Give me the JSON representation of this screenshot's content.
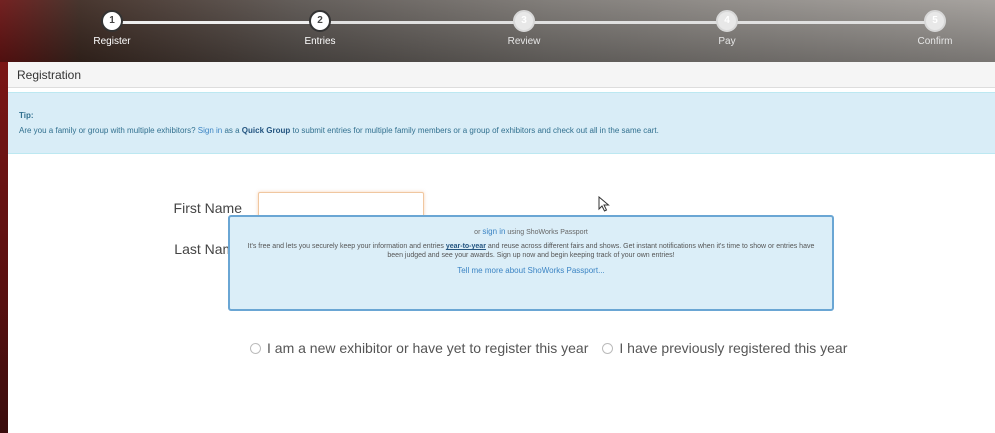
{
  "wizard": {
    "steps": [
      {
        "number": "1",
        "label": "Register",
        "state": "done"
      },
      {
        "number": "2",
        "label": "Entries",
        "state": "current"
      },
      {
        "number": "3",
        "label": "Review",
        "state": "pending"
      },
      {
        "number": "4",
        "label": "Pay",
        "state": "pending"
      },
      {
        "number": "5",
        "label": "Confirm",
        "state": "pending"
      }
    ]
  },
  "panel": {
    "title": "Registration"
  },
  "tip": {
    "title": "Tip:",
    "text_before": "Are you a family or group with multiple exhibitors? ",
    "sign_in_link": "Sign in",
    "text_middle": " as a ",
    "quick_group_link": "Quick Group",
    "text_after": " to submit entries for multiple family members or a group of exhibitors and check out all in the same cart."
  },
  "form": {
    "first_name_label": "First Name",
    "first_name_value": "",
    "last_name_label": "Last Name",
    "last_name_value": ""
  },
  "passport": {
    "or_text": "or ",
    "sign_in_link": "sign in",
    "using_text": " using ShoWorks Passport",
    "body_before": "It's free and lets you securely keep your information and entries ",
    "year_to_year": "year-to-year",
    "body_after": " and reuse across different fairs and shows. Get instant notifications when it's time to show or entries have been judged and see your awards. Sign up now and begin keeping track of your own entries!",
    "more_link": "Tell me more about ShoWorks Passport..."
  },
  "exhibitor_type": {
    "option_new": "I am a new exhibitor or have yet to register this year",
    "option_previous": "I have previously registered this year"
  },
  "colors": {
    "tip_background": "#d9edf7",
    "link": "#3b84c4",
    "passport_border": "#6aa6d4"
  }
}
